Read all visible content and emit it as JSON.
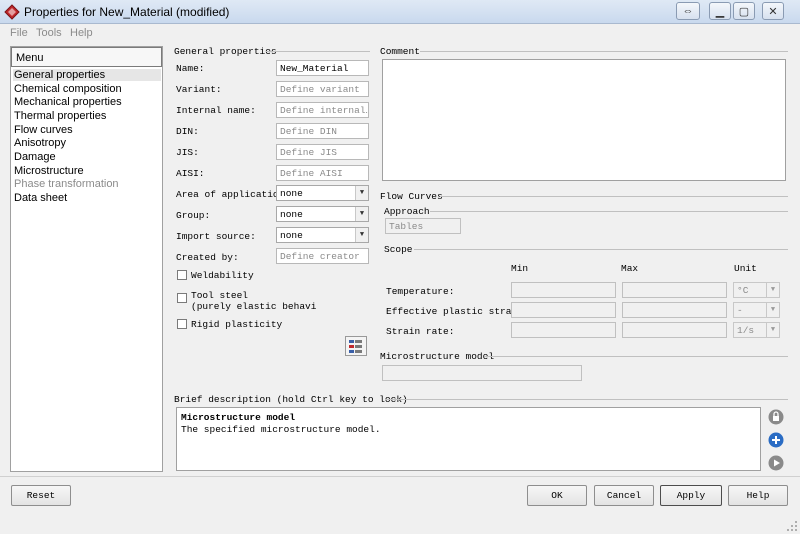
{
  "window": {
    "title": "Properties for New_Material (modified)"
  },
  "menubar": [
    "File",
    "Tools",
    "Help"
  ],
  "menu": {
    "header": "Menu",
    "items": [
      {
        "label": "General properties",
        "state": "selected"
      },
      {
        "label": "Chemical composition",
        "state": "normal"
      },
      {
        "label": "Mechanical properties",
        "state": "normal"
      },
      {
        "label": "Thermal properties",
        "state": "normal"
      },
      {
        "label": "Flow curves",
        "state": "normal"
      },
      {
        "label": "Anisotropy",
        "state": "normal"
      },
      {
        "label": "Damage",
        "state": "normal"
      },
      {
        "label": "Microstructure",
        "state": "normal"
      },
      {
        "label": "Phase transformation",
        "state": "disabled"
      },
      {
        "label": "Data sheet",
        "state": "normal"
      }
    ]
  },
  "general": {
    "title": "General properties",
    "name_label": "Name:",
    "name_value": "New_Material",
    "variant_label": "Variant:",
    "variant_placeholder": "Define variant",
    "internal_label": "Internal name:",
    "internal_placeholder": "Define internal…",
    "din_label": "DIN:",
    "din_placeholder": "Define DIN",
    "jis_label": "JIS:",
    "jis_placeholder": "Define JIS",
    "aisi_label": "AISI:",
    "aisi_placeholder": "Define AISI",
    "area_label": "Area of application:",
    "area_value": "none",
    "group_label": "Group:",
    "group_value": "none",
    "import_label": "Import source:",
    "import_value": "none",
    "creator_label": "Created by:",
    "creator_placeholder": "Define creator",
    "weldability_label": "Weldability",
    "toolsteel_label": "Tool steel",
    "toolsteel_sub": "(purely elastic behavi",
    "rigid_label": "Rigid plasticity"
  },
  "comment": {
    "title": "Comment"
  },
  "flow": {
    "title": "Flow Curves",
    "approach_label": "Approach",
    "approach_value": "Tables",
    "scope_label": "Scope",
    "min_header": "Min",
    "max_header": "Max",
    "unit_header": "Unit",
    "rows": [
      {
        "label": "Temperature:",
        "unit": "°C"
      },
      {
        "label": "Effective plastic strain:",
        "unit": "-"
      },
      {
        "label": "Strain rate:",
        "unit": "1/s"
      }
    ],
    "micro_label": "Microstructure model"
  },
  "brief": {
    "title": "Brief description (hold Ctrl key to lock)",
    "heading": "Microstructure model",
    "text": "The specified microstructure model."
  },
  "buttons": {
    "reset": "Reset",
    "ok": "OK",
    "cancel": "Cancel",
    "apply": "Apply",
    "help": "Help"
  },
  "colors": {
    "accent": "#c0282d",
    "window_bg": "#f0f0f0",
    "titlebar": "#c9d9ee"
  }
}
